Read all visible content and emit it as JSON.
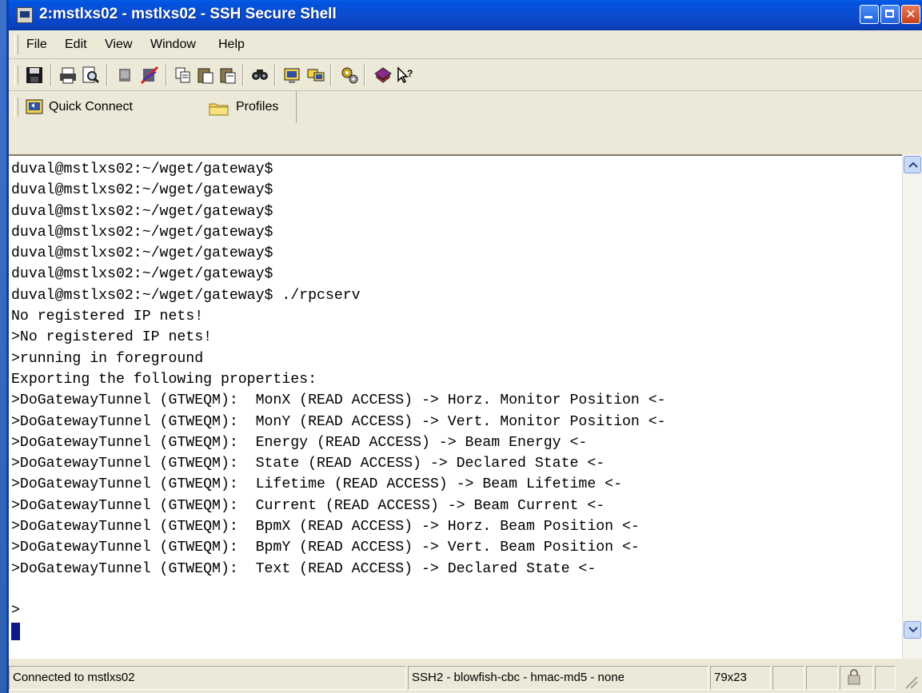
{
  "window": {
    "title": "2:mstlxs02 - mstlxs02 - SSH Secure Shell"
  },
  "menu": {
    "items": [
      "File",
      "Edit",
      "View",
      "Window",
      "Help"
    ]
  },
  "toolbar": {
    "icons": [
      "save-icon",
      "print-icon",
      "print-preview-icon",
      "disconnect-icon",
      "disconnect-settings-icon",
      "copy-icon",
      "paste-icon",
      "paste-special-icon",
      "find-icon",
      "new-terminal-icon",
      "new-file-transfer-icon",
      "settings-icon",
      "help-topics-icon",
      "context-help-icon"
    ]
  },
  "quickbar": {
    "quick_connect": "Quick Connect",
    "profiles": "Profiles"
  },
  "terminal": {
    "lines": [
      "duval@mstlxs02:~/wget/gateway$",
      "duval@mstlxs02:~/wget/gateway$",
      "duval@mstlxs02:~/wget/gateway$",
      "duval@mstlxs02:~/wget/gateway$",
      "duval@mstlxs02:~/wget/gateway$",
      "duval@mstlxs02:~/wget/gateway$",
      "duval@mstlxs02:~/wget/gateway$ ./rpcserv",
      "No registered IP nets!",
      ">No registered IP nets!",
      ">running in foreground",
      "Exporting the following properties:",
      ">DoGatewayTunnel (GTWEQM):  MonX (READ ACCESS) -> Horz. Monitor Position <-",
      ">DoGatewayTunnel (GTWEQM):  MonY (READ ACCESS) -> Vert. Monitor Position <-",
      ">DoGatewayTunnel (GTWEQM):  Energy (READ ACCESS) -> Beam Energy <-",
      ">DoGatewayTunnel (GTWEQM):  State (READ ACCESS) -> Declared State <-",
      ">DoGatewayTunnel (GTWEQM):  Lifetime (READ ACCESS) -> Beam Lifetime <-",
      ">DoGatewayTunnel (GTWEQM):  Current (READ ACCESS) -> Beam Current <-",
      ">DoGatewayTunnel (GTWEQM):  BpmX (READ ACCESS) -> Horz. Beam Position <-",
      ">DoGatewayTunnel (GTWEQM):  BpmY (READ ACCESS) -> Vert. Beam Position <-",
      ">DoGatewayTunnel (GTWEQM):  Text (READ ACCESS) -> Declared State <-",
      "",
      ">"
    ]
  },
  "status": {
    "connection": "Connected to mstlxs02",
    "protocol": "SSH2 - blowfish-cbc - hmac-md5 - none",
    "size": "79x23"
  },
  "colors": {
    "titlebar": "#0a4fd2",
    "chrome": "#ece9d8",
    "cursor": "#0a1a8a"
  }
}
